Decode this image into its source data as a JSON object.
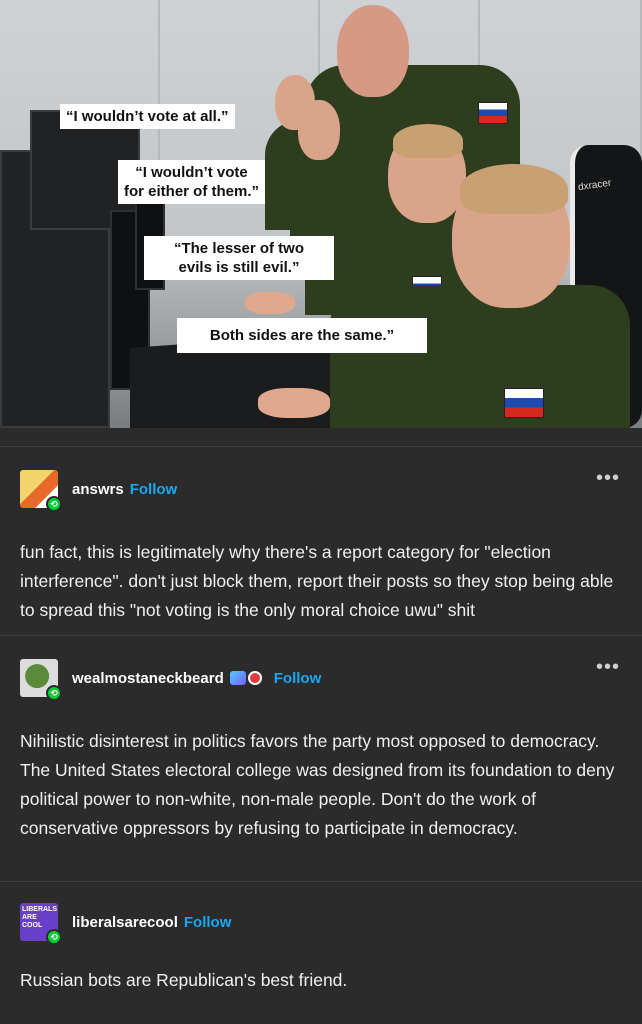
{
  "meme": {
    "captions": [
      "“I wouldn’t vote at all.”",
      "“I wouldn’t vote for either of them.”",
      "“The lesser of two evils is still evil.”",
      "Both sides are the same.”"
    ],
    "captions_split": {
      "c1": "“I wouldn’t vote at all.”",
      "c2a": "“I wouldn’t vote",
      "c2b": "for either of them.”",
      "c3a": "“The lesser of two",
      "c3b": "evils is still evil.”",
      "c4": "Both sides are the same.”"
    },
    "chair_brand": "dxracer"
  },
  "posts": [
    {
      "username": "answrs",
      "follow_label": "Follow",
      "more_label": "•••",
      "body": "fun fact, this is legitimately why there's a report category for \"election interference\". don't just block them, report their posts so they stop being able to spread this \"not voting is the only moral choice uwu\" shit",
      "avatar_icon": "cartoon-avatar-icon"
    },
    {
      "username": "wealmostaneckbeard",
      "follow_label": "Follow",
      "more_label": "•••",
      "body": "Nihilistic disinterest in politics favors the party most opposed to democracy. The United States electoral college was designed from its foundation to deny political power to non-white, non-male people. Don't do the work of conservative oppressors by refusing to participate in democracy.",
      "avatar_icon": "lizard-avatar-icon"
    },
    {
      "username": "liberalsarecool",
      "follow_label": "Follow",
      "body": "Russian bots are Republican's best friend.",
      "avatar_text": "LIBERALS ARE COOL",
      "avatar_icon": "text-logo-avatar-icon"
    }
  ],
  "colors": {
    "background": "#2b2b2b",
    "follow": "#1aa7f2",
    "reblog_badge": "#00cf35"
  }
}
